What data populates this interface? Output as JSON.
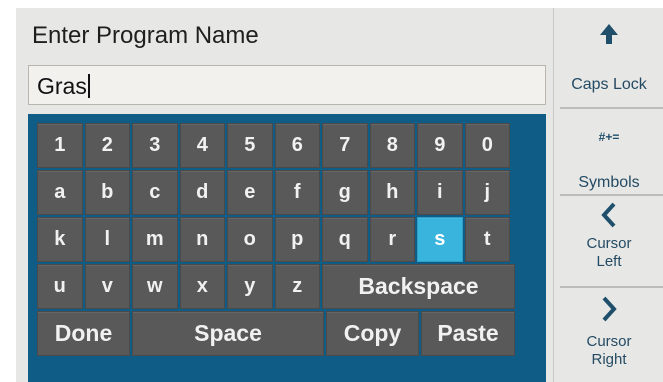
{
  "title": "Enter Program Name",
  "name_field": {
    "value": "Gras"
  },
  "keyboard": {
    "rows": [
      [
        "1",
        "2",
        "3",
        "4",
        "5",
        "6",
        "7",
        "8",
        "9",
        "0"
      ],
      [
        "a",
        "b",
        "c",
        "d",
        "e",
        "f",
        "g",
        "h",
        "i",
        "j"
      ],
      [
        "k",
        "l",
        "m",
        "n",
        "o",
        "p",
        "q",
        "r",
        "s",
        "t"
      ],
      [
        "u",
        "v",
        "w",
        "x",
        "y",
        "z"
      ]
    ],
    "selected_key": "s",
    "backspace": "Backspace",
    "done": "Done",
    "space": "Space",
    "copy": "Copy",
    "paste": "Paste"
  },
  "side": {
    "caps_lock": "Caps Lock",
    "symbols_glyph": "#+=",
    "symbols": "Symbols",
    "cursor_left_1": "Cursor",
    "cursor_left_2": "Left",
    "cursor_right_1": "Cursor",
    "cursor_right_2": "Right"
  },
  "colors": {
    "keyboard_bg": "#0f5d86",
    "key_bg": "#595959",
    "key_selected": "#39b4dc",
    "side_accent": "#1f4f6b"
  },
  "icons": {
    "caps_lock": "arrow-up-icon",
    "cursor_left": "chevron-left-icon",
    "cursor_right": "chevron-right-icon"
  }
}
